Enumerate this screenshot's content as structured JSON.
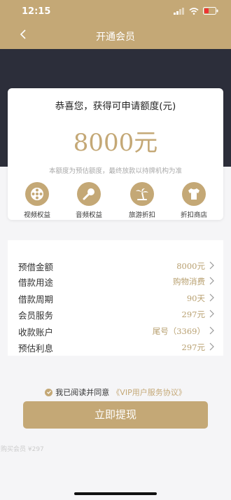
{
  "status_bar": {
    "time": "12:15"
  },
  "nav": {
    "title": "开通会员",
    "back_icon": "chevron-left-icon"
  },
  "card": {
    "title": "恭喜您，获得可申请额度(元)",
    "amount": "8000元",
    "note": "本额度为预估额度，最终放款以持牌机构为准",
    "benefits": [
      {
        "label": "视频权益",
        "icon": "film-reel-icon"
      },
      {
        "label": "音频权益",
        "icon": "microphone-icon"
      },
      {
        "label": "旅游折扣",
        "icon": "palm-tree-icon"
      },
      {
        "label": "折扣商店",
        "icon": "tshirt-icon"
      }
    ]
  },
  "info": {
    "rows": [
      {
        "label": "预借金额",
        "value": "8000元"
      },
      {
        "label": "借款用途",
        "value": "购物消费"
      },
      {
        "label": "借款周期",
        "value": "90天"
      },
      {
        "label": "会员服务",
        "value": "297元"
      },
      {
        "label": "收款账户",
        "value": "尾号（3369）"
      },
      {
        "label": "预估利息",
        "value": "297元"
      }
    ]
  },
  "agreement": {
    "prefix": "我已阅读并同意",
    "link": "《VIP用户服务协议》"
  },
  "submit": {
    "label": "立即提现"
  },
  "footer_note": "购买会员 ¥297",
  "colors": {
    "accent": "#c4a876",
    "dark": "#2c2e3a",
    "background": "#f5f5f7"
  }
}
